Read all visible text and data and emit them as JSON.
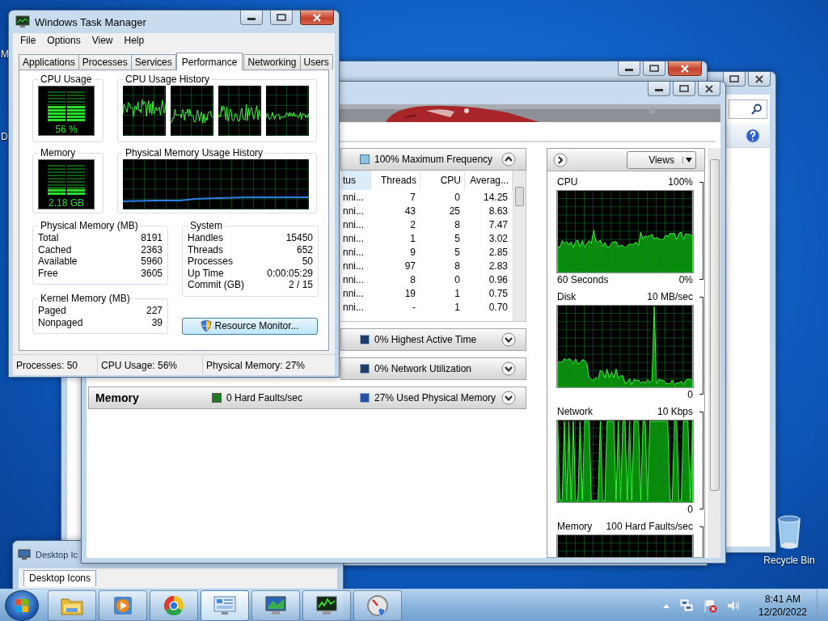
{
  "task_manager": {
    "title": "Windows Task Manager",
    "menu": [
      "File",
      "Options",
      "View",
      "Help"
    ],
    "tabs": [
      {
        "label": "Applications",
        "selected": false
      },
      {
        "label": "Processes",
        "selected": false
      },
      {
        "label": "Services",
        "selected": false
      },
      {
        "label": "Performance",
        "selected": true
      },
      {
        "label": "Networking",
        "selected": false
      },
      {
        "label": "Users",
        "selected": false
      }
    ],
    "cpu_usage": {
      "title": "CPU Usage",
      "reading": "56 %"
    },
    "cpu_history": {
      "title": "CPU Usage History"
    },
    "memory": {
      "title": "Memory",
      "reading": "2.18 GB"
    },
    "memory_history": {
      "title": "Physical Memory Usage History"
    },
    "physical_memory": {
      "title": "Physical Memory (MB)",
      "rows": [
        {
          "label": "Total",
          "value": "8191"
        },
        {
          "label": "Cached",
          "value": "2363"
        },
        {
          "label": "Available",
          "value": "5960"
        },
        {
          "label": "Free",
          "value": "3605"
        }
      ]
    },
    "kernel_memory": {
      "title": "Kernel Memory (MB)",
      "rows": [
        {
          "label": "Paged",
          "value": "227"
        },
        {
          "label": "Nonpaged",
          "value": "39"
        }
      ]
    },
    "system": {
      "title": "System",
      "rows": [
        {
          "label": "Handles",
          "value": "15450"
        },
        {
          "label": "Threads",
          "value": "652"
        },
        {
          "label": "Processes",
          "value": "50"
        },
        {
          "label": "Up Time",
          "value": "0:00:05:29"
        },
        {
          "label": "Commit (GB)",
          "value": "2 / 15"
        }
      ]
    },
    "resource_monitor_button": "Resource Monitor...",
    "status_bar": [
      "Processes: 50",
      "CPU Usage: 56%",
      "Physical Memory: 27%"
    ]
  },
  "resource_monitor": {
    "sections": [
      {
        "kind": "cpu",
        "summary": "100% Maximum Frequency",
        "expanded": true,
        "table": {
          "columns": [
            "tus",
            "Threads",
            "CPU",
            "Averag..."
          ],
          "rows": [
            [
              "nni...",
              "7",
              "0",
              "14.25"
            ],
            [
              "nni...",
              "43",
              "25",
              "8.63"
            ],
            [
              "nni...",
              "2",
              "8",
              "7.47"
            ],
            [
              "nni...",
              "1",
              "5",
              "3.02"
            ],
            [
              "nni...",
              "9",
              "5",
              "2.85"
            ],
            [
              "nni...",
              "97",
              "8",
              "2.83"
            ],
            [
              "nni...",
              "8",
              "0",
              "0.96"
            ],
            [
              "nni...",
              "19",
              "1",
              "0.75"
            ],
            [
              "nni...",
              "-",
              "1",
              "0.70"
            ]
          ]
        }
      },
      {
        "kind": "disk",
        "summary": "0% Highest Active Time",
        "expanded": false
      },
      {
        "kind": "network",
        "summary": "0% Network Utilization",
        "expanded": false
      },
      {
        "kind": "memory",
        "title": "Memory",
        "faults": "0 Hard Faults/sec",
        "summary": "27% Used Physical Memory",
        "expanded": false
      }
    ],
    "views_button": "Views",
    "graphs": [
      {
        "label": "CPU",
        "max": "100%",
        "span": "60 Seconds",
        "min": "0%"
      },
      {
        "label": "Disk",
        "max": "10 MB/sec",
        "min": "0"
      },
      {
        "label": "Network",
        "max": "10 Kbps",
        "min": "0"
      },
      {
        "label": "Memory",
        "max": "100 Hard Faults/sec"
      }
    ]
  },
  "desktop_icons_window": {
    "title": "Desktop Ic",
    "tabs": [
      {
        "label": "Desktop Icons",
        "selected": true
      }
    ]
  },
  "desktop": {
    "icon_labels": [
      "M",
      "D"
    ],
    "recycle_bin": "Recycle Bin"
  },
  "taskbar": {
    "apps": [
      {
        "kind": "folder",
        "selected": false
      },
      {
        "kind": "media",
        "selected": false
      },
      {
        "kind": "browser",
        "selected": false
      },
      {
        "kind": "panel",
        "selected": true
      },
      {
        "kind": "monitor",
        "selected": false
      },
      {
        "kind": "resmon",
        "selected": false
      },
      {
        "kind": "gauge",
        "selected": false
      }
    ],
    "clock": {
      "time": "8:41 AM",
      "date": "12/20/2022"
    }
  }
}
